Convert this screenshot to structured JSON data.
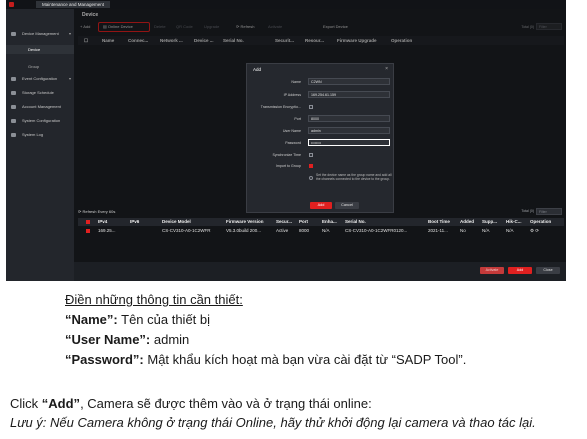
{
  "app": {
    "window_title": "Maintenance and Management",
    "page_title": "Device"
  },
  "sidebar": {
    "items": [
      {
        "label": "Device Management",
        "has_chevron": true
      },
      {
        "label": "Device",
        "sub": true
      },
      {
        "label": "Group",
        "sub": true
      },
      {
        "label": "Event Configuration",
        "has_chevron": true
      },
      {
        "label": "Storage Schedule"
      },
      {
        "label": "Account Management"
      },
      {
        "label": "System Configuration"
      },
      {
        "label": "System Log"
      }
    ]
  },
  "toolbar": {
    "add": "Add",
    "online_device": "Online Device",
    "delete": "Delete",
    "qr_code": "QR Code",
    "upgrade": "Upgrade",
    "refresh": "Refresh",
    "activate": "Activate",
    "export": "Export Device",
    "total": "Total (0)",
    "filter_placeholder": "Filter"
  },
  "table_headers": [
    "Name",
    "Connec...",
    "Network ...",
    "Device ...",
    "Serial No.",
    "Securit...",
    "Resour...",
    "Firmware Upgrade",
    "Operation"
  ],
  "dialog": {
    "title": "Add",
    "fields": {
      "name_label": "Name",
      "name_value": "C2WN",
      "ip_label": "IP Address",
      "ip_value": "169.254.61.159",
      "transmission_label": "Transmission Encryptio...",
      "port_label": "Port",
      "port_value": "8000",
      "username_label": "User Name",
      "username_value": "admin",
      "password_label": "Password",
      "password_value": "••••••••",
      "sync_label": "Synchronize Time",
      "import_label": "Import to Group",
      "import_note": "Set the device name as the group name and add all the channels connected to the device to the group."
    },
    "add_button": "Add",
    "cancel_button": "Cancel"
  },
  "online_list": {
    "refresh_label": "Refresh Every 60s",
    "total": "Total (0)",
    "filter_placeholder": "Filter",
    "headers": [
      "IPv4",
      "IPv6",
      "Device Model",
      "Firmware Version",
      "Secur...",
      "Port",
      "Enha...",
      "Serial No.",
      "Boot Time",
      "Added",
      "Supp...",
      "Hik-C...",
      "Operation"
    ],
    "rows": [
      [
        "169.25...",
        "",
        "CS-CV310-A0-1C2WFR",
        "V5.3.0build 200...",
        "Active",
        "8000",
        "N/A",
        "CS-CV310-A0-1C2WFR0120...",
        "2021-11...",
        "No",
        "N/A",
        "N/A",
        "⚙ ⟳"
      ]
    ]
  },
  "bottom_buttons": {
    "activate": "Activate",
    "add": "Add",
    "close": "Close"
  },
  "instructions": {
    "heading": "Điền những thông tin cần thiết:",
    "line1_bold": "“Name”:",
    "line1_rest": " Tên của thiết bị",
    "line2_bold": "“User Name”:",
    "line2_rest": " admin",
    "line3_bold": "“Password”:",
    "line3_rest": " Mật khẩu kích hoạt mà bạn vừa cài đặt từ “SADP Tool”.",
    "click_pre": "Click ",
    "click_bold": "“Add”",
    "click_post": ", Camera sẽ được thêm vào và ở trạng thái online:",
    "note": "Lưu ý: Nếu Camera không ở trạng thái Online, hãy thử khởi động lại camera và thao tác lại."
  },
  "colors": {
    "accent_red": "#e02020",
    "bg_dark": "#1c1f24"
  }
}
